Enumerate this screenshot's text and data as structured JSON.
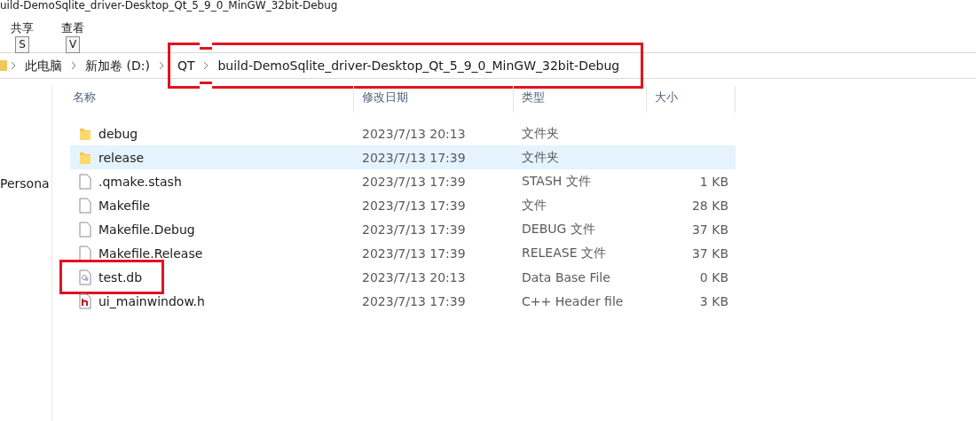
{
  "window": {
    "title": "uild-DemoSqlite_driver-Desktop_Qt_5_9_0_MinGW_32bit-Debug"
  },
  "ribbon_tabs": [
    {
      "label": "共享",
      "key_tip": "S"
    },
    {
      "label": "查看",
      "key_tip": "V"
    }
  ],
  "breadcrumb": [
    {
      "label": "此电脑",
      "boxed": false
    },
    {
      "label": "新加卷 (D:)",
      "boxed": false
    },
    {
      "label": "QT",
      "boxed": true
    },
    {
      "label": "build-DemoSqlite_driver-Desktop_Qt_5_9_0_MinGW_32bit-Debug",
      "boxed": true
    }
  ],
  "sidebar": {
    "items": [
      {
        "label": "Persona"
      }
    ]
  },
  "table": {
    "columns": [
      "名称",
      "修改日期",
      "类型",
      "大小"
    ],
    "rows": [
      {
        "kind": "folder",
        "name": "debug",
        "modified": "2023/7/13 20:13",
        "type": "文件夹",
        "size": "",
        "selected": false,
        "boxed": false
      },
      {
        "kind": "folder",
        "name": "release",
        "modified": "2023/7/13 17:39",
        "type": "文件夹",
        "size": "",
        "selected": true,
        "boxed": false
      },
      {
        "kind": "file",
        "name": ".qmake.stash",
        "modified": "2023/7/13 17:39",
        "type": "STASH 文件",
        "size": "1 KB",
        "selected": false,
        "boxed": false
      },
      {
        "kind": "file",
        "name": "Makefile",
        "modified": "2023/7/13 17:39",
        "type": "文件",
        "size": "28 KB",
        "selected": false,
        "boxed": false
      },
      {
        "kind": "file",
        "name": "Makefile.Debug",
        "modified": "2023/7/13 17:39",
        "type": "DEBUG 文件",
        "size": "37 KB",
        "selected": false,
        "boxed": false
      },
      {
        "kind": "file",
        "name": "Makefile.Release",
        "modified": "2023/7/13 17:39",
        "type": "RELEASE 文件",
        "size": "37 KB",
        "selected": false,
        "boxed": false
      },
      {
        "kind": "database",
        "name": "test.db",
        "modified": "2023/7/13 20:13",
        "type": "Data Base File",
        "size": "0 KB",
        "selected": false,
        "boxed": true
      },
      {
        "kind": "header",
        "name": "ui_mainwindow.h",
        "modified": "2023/7/13 17:39",
        "type": "C++ Header file",
        "size": "3 KB",
        "selected": false,
        "boxed": false
      }
    ]
  }
}
